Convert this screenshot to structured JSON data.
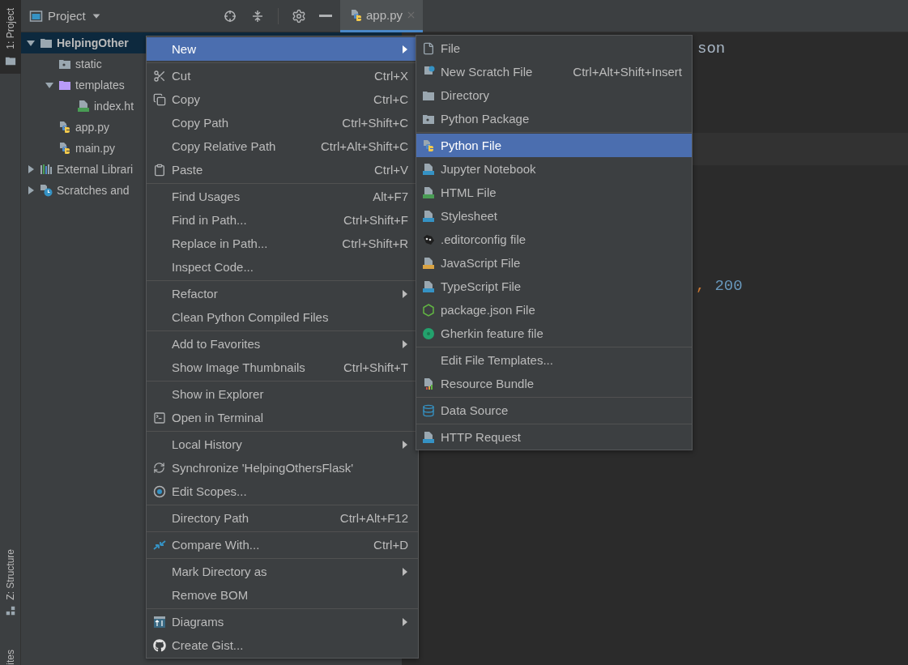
{
  "tool_strip": {
    "top_tab": {
      "label": "1: Project",
      "selected": true
    },
    "bottom_tabs": [
      {
        "label": "Z: Structure"
      },
      {
        "label": "ites"
      }
    ]
  },
  "project_panel": {
    "title": "Project",
    "tree": [
      {
        "label": "HelpingOther",
        "kind": "folder",
        "selected": true,
        "expanded": true,
        "children": [
          {
            "label": "static",
            "kind": "resource_folder",
            "selected": false
          },
          {
            "label": "templates",
            "kind": "template_folder",
            "selected": false,
            "expanded": true,
            "children": [
              {
                "label": "index.ht",
                "kind": "html",
                "selected": false
              }
            ]
          },
          {
            "label": "app.py",
            "kind": "python",
            "selected": false
          },
          {
            "label": "main.py",
            "kind": "python",
            "selected": false
          }
        ]
      },
      {
        "label": "External Librari",
        "kind": "library",
        "selected": false,
        "expanded": false
      },
      {
        "label": "Scratches and",
        "kind": "scratches",
        "selected": false,
        "expanded": false
      }
    ]
  },
  "editor_tabs": [
    {
      "label": "app.py",
      "selected": true
    }
  ],
  "editor": {
    "lines": [
      {
        "tokens": [
          {
            "text": "son",
            "kind": "plain"
          }
        ]
      },
      {
        "tokens": [
          {
            "text": ",",
            "kind": "punct"
          },
          {
            "text": "200",
            "kind": "number"
          }
        ]
      }
    ]
  },
  "context_menu": {
    "items": [
      {
        "kind": "item",
        "label": "New",
        "submenu": true,
        "selected": true
      },
      {
        "kind": "separator"
      },
      {
        "kind": "item",
        "label": "Cut",
        "shortcut": "Ctrl+X",
        "submenu": false,
        "selected": false
      },
      {
        "kind": "item",
        "label": "Copy",
        "shortcut": "Ctrl+C",
        "submenu": false,
        "selected": false
      },
      {
        "kind": "item",
        "label": "Copy Path",
        "shortcut": "Ctrl+Shift+C",
        "submenu": false,
        "selected": false
      },
      {
        "kind": "item",
        "label": "Copy Relative Path",
        "shortcut": "Ctrl+Alt+Shift+C",
        "submenu": false,
        "selected": false
      },
      {
        "kind": "item",
        "label": "Paste",
        "shortcut": "Ctrl+V",
        "submenu": false,
        "selected": false
      },
      {
        "kind": "separator"
      },
      {
        "kind": "item",
        "label": "Find Usages",
        "shortcut": "Alt+F7",
        "submenu": false,
        "selected": false
      },
      {
        "kind": "item",
        "label": "Find in Path...",
        "shortcut": "Ctrl+Shift+F",
        "submenu": false,
        "selected": false
      },
      {
        "kind": "item",
        "label": "Replace in Path...",
        "shortcut": "Ctrl+Shift+R",
        "submenu": false,
        "selected": false
      },
      {
        "kind": "item",
        "label": "Inspect Code...",
        "submenu": false,
        "selected": false
      },
      {
        "kind": "separator"
      },
      {
        "kind": "item",
        "label": "Refactor",
        "submenu": true,
        "selected": false
      },
      {
        "kind": "item",
        "label": "Clean Python Compiled Files",
        "submenu": false,
        "selected": false
      },
      {
        "kind": "separator"
      },
      {
        "kind": "item",
        "label": "Add to Favorites",
        "submenu": true,
        "selected": false
      },
      {
        "kind": "item",
        "label": "Show Image Thumbnails",
        "shortcut": "Ctrl+Shift+T",
        "submenu": false,
        "selected": false
      },
      {
        "kind": "separator"
      },
      {
        "kind": "item",
        "label": "Show in Explorer",
        "submenu": false,
        "selected": false
      },
      {
        "kind": "item",
        "label": "Open in Terminal",
        "submenu": false,
        "selected": false
      },
      {
        "kind": "separator"
      },
      {
        "kind": "item",
        "label": "Local History",
        "submenu": true,
        "selected": false
      },
      {
        "kind": "item",
        "label": "Synchronize 'HelpingOthersFlask'",
        "submenu": false,
        "selected": false
      },
      {
        "kind": "item",
        "label": "Edit Scopes...",
        "submenu": false,
        "selected": false
      },
      {
        "kind": "separator"
      },
      {
        "kind": "item",
        "label": "Directory Path",
        "shortcut": "Ctrl+Alt+F12",
        "submenu": false,
        "selected": false
      },
      {
        "kind": "separator"
      },
      {
        "kind": "item",
        "label": "Compare With...",
        "shortcut": "Ctrl+D",
        "submenu": false,
        "selected": false
      },
      {
        "kind": "separator"
      },
      {
        "kind": "item",
        "label": "Mark Directory as",
        "submenu": true,
        "selected": false
      },
      {
        "kind": "item",
        "label": "Remove BOM",
        "submenu": false,
        "selected": false
      },
      {
        "kind": "separator"
      },
      {
        "kind": "item",
        "label": "Diagrams",
        "submenu": true,
        "selected": false
      },
      {
        "kind": "item",
        "label": "Create Gist...",
        "submenu": false,
        "selected": false
      }
    ]
  },
  "submenu": {
    "items": [
      {
        "kind": "item",
        "label": "File",
        "selected": false
      },
      {
        "kind": "item",
        "label": "New Scratch File",
        "shortcut": "Ctrl+Alt+Shift+Insert",
        "selected": false
      },
      {
        "kind": "item",
        "label": "Directory",
        "selected": false
      },
      {
        "kind": "item",
        "label": "Python Package",
        "selected": false
      },
      {
        "kind": "separator"
      },
      {
        "kind": "item",
        "label": "Python File",
        "selected": true
      },
      {
        "kind": "item",
        "label": "Jupyter Notebook",
        "selected": false
      },
      {
        "kind": "item",
        "label": "HTML File",
        "selected": false
      },
      {
        "kind": "item",
        "label": "Stylesheet",
        "selected": false
      },
      {
        "kind": "item",
        "label": ".editorconfig file",
        "selected": false
      },
      {
        "kind": "item",
        "label": "JavaScript File",
        "selected": false
      },
      {
        "kind": "item",
        "label": "TypeScript File",
        "selected": false
      },
      {
        "kind": "item",
        "label": "package.json File",
        "selected": false
      },
      {
        "kind": "item",
        "label": "Gherkin feature file",
        "selected": false
      },
      {
        "kind": "separator"
      },
      {
        "kind": "item",
        "label": "Edit File Templates...",
        "selected": false
      },
      {
        "kind": "item",
        "label": "Resource Bundle",
        "selected": false
      },
      {
        "kind": "separator"
      },
      {
        "kind": "item",
        "label": "Data Source",
        "selected": false
      },
      {
        "kind": "separator"
      },
      {
        "kind": "item",
        "label": "HTTP Request",
        "selected": false
      }
    ]
  }
}
